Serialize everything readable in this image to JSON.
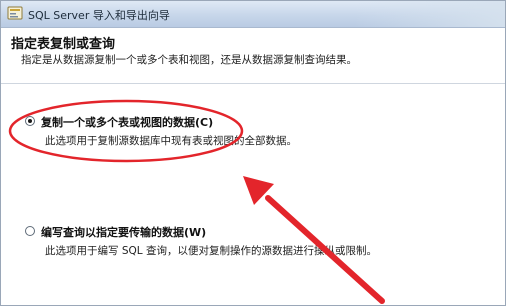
{
  "window": {
    "title": "SQL Server 导入和导出向导",
    "icon": "wizard-app-icon"
  },
  "header": {
    "heading": "指定表复制或查询",
    "description": "指定是从数据源复制一个或多个表和视图，还是从数据源复制查询结果。"
  },
  "options": [
    {
      "label": "复制一个或多个表或视图的数据(C)",
      "description": "此选项用于复制源数据库中现有表或视图的全部数据。",
      "selected": true
    },
    {
      "label": "编写查询以指定要传输的数据(W)",
      "description": "此选项用于编写 SQL 查询，以便对复制操作的源数据进行操纵或限制。",
      "selected": false
    }
  ],
  "annotations": {
    "highlight_color": "#e3252b",
    "arrow_color": "#e3252b"
  }
}
